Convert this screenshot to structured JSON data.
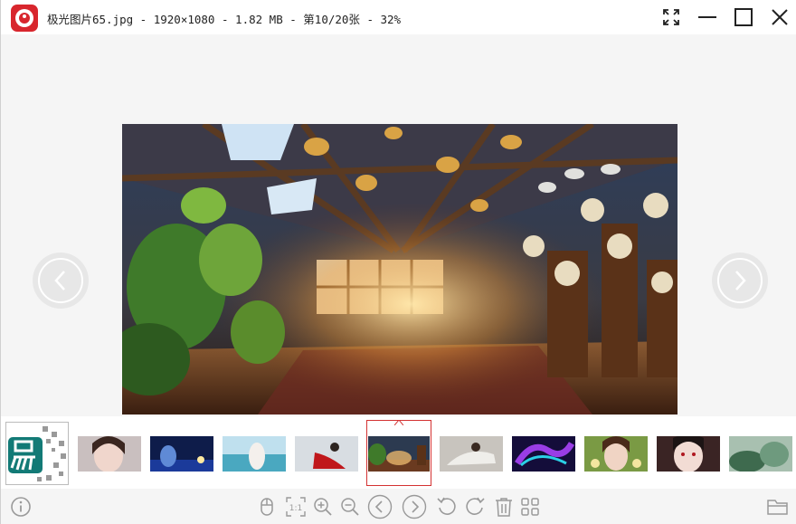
{
  "window": {
    "title": "极光图片65.jpg - 1920×1080 - 1.82 MB - 第10/20张 - 32%",
    "controls": [
      "fullscreen",
      "minimize",
      "maximize",
      "close"
    ]
  },
  "viewer": {
    "nav_prev": "previous-image",
    "nav_next": "next-image"
  },
  "thumbnails": [
    {
      "name": "easy-logo",
      "selected": false
    },
    {
      "name": "girl-portrait",
      "selected": false
    },
    {
      "name": "anime-night",
      "selected": false
    },
    {
      "name": "beach-girl",
      "selected": false
    },
    {
      "name": "snow-red-dress",
      "selected": false
    },
    {
      "name": "attic-plants-clocks",
      "selected": true
    },
    {
      "name": "reading-room",
      "selected": false
    },
    {
      "name": "neon-dragon",
      "selected": false
    },
    {
      "name": "flower-girl",
      "selected": false
    },
    {
      "name": "red-eye-girl",
      "selected": false
    },
    {
      "name": "green-forest",
      "selected": false
    }
  ],
  "toolbar": {
    "buttons": [
      "mouse",
      "actual-size",
      "zoom-in",
      "zoom-out",
      "previous",
      "next",
      "rotate-left",
      "rotate-right",
      "delete",
      "grid"
    ],
    "actual_size_label": "1:1",
    "info": "info",
    "folder": "folder"
  },
  "colors": {
    "accent": "#d8262d",
    "selection": "#d43232",
    "icon": "#9a9a9a"
  }
}
